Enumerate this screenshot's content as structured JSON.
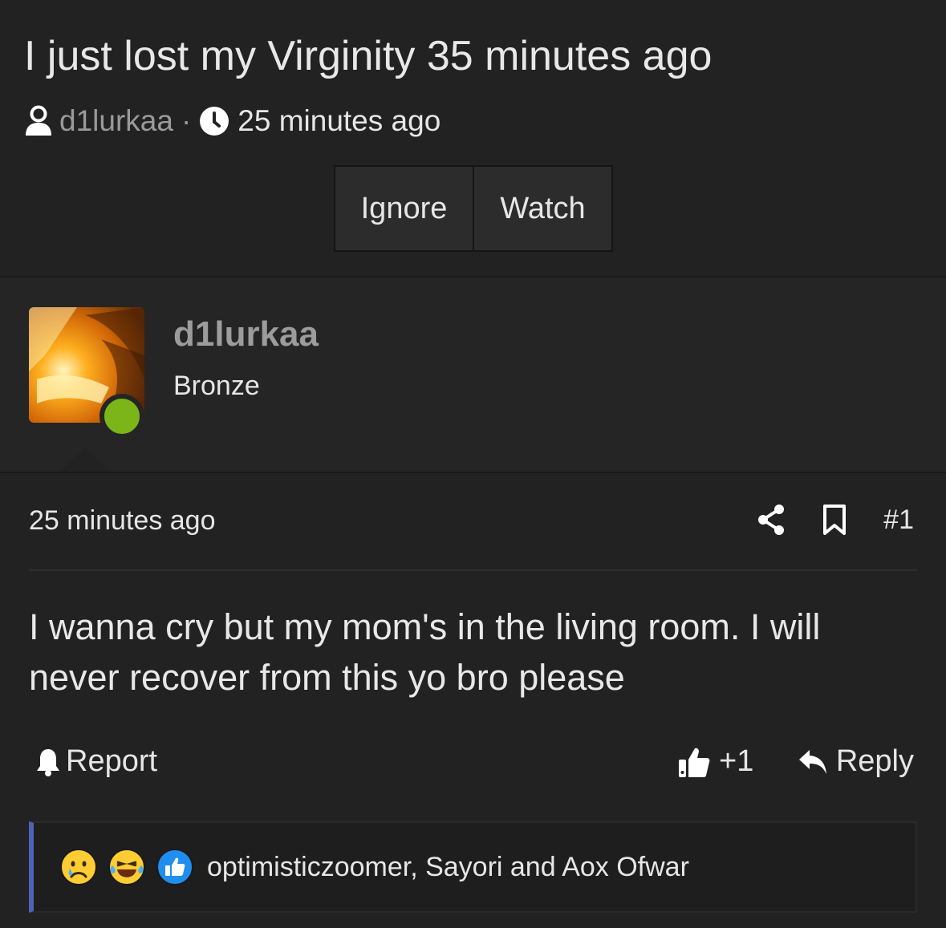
{
  "thread": {
    "title": "I just lost my Virginity 35 minutes ago",
    "author": "d1lurkaa",
    "separator": "·",
    "time": "25 minutes ago",
    "buttons": {
      "ignore": "Ignore",
      "watch": "Watch"
    }
  },
  "poster": {
    "name": "d1lurkaa",
    "rank": "Bronze",
    "online_color": "#7cb518"
  },
  "post": {
    "time": "25 minutes ago",
    "number": "#1",
    "text": "I wanna cry but my mom's in the living room. I will never recover from this yo bro please",
    "report_label": "Report",
    "like_count": "+1",
    "reply_label": "Reply"
  },
  "reactions": {
    "icons": [
      "sad-emoji",
      "laughing-crying-emoji",
      "like-emoji"
    ],
    "names": "optimisticzoomer, Sayori and Aox Ofwar"
  }
}
